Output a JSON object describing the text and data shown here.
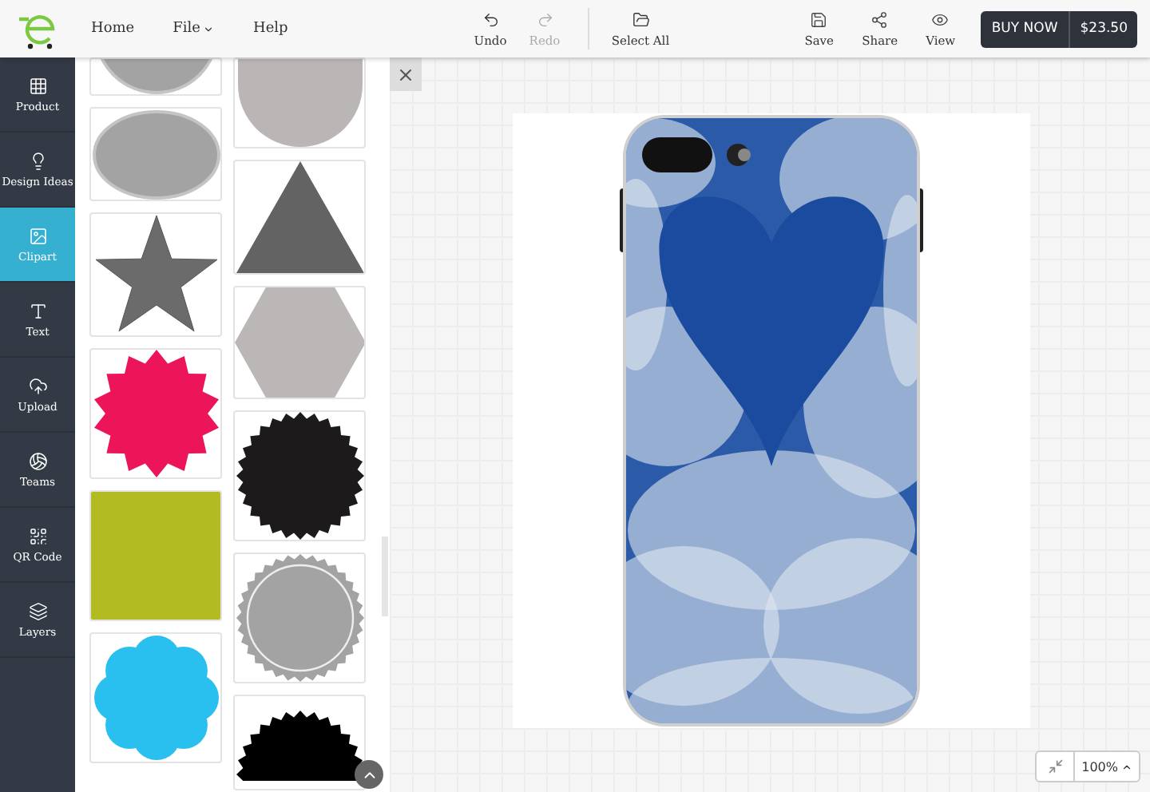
{
  "menu": [
    {
      "label": "Home"
    },
    {
      "label": "File",
      "dropdown": true
    },
    {
      "label": "Help"
    }
  ],
  "toolbar": [
    {
      "label": "Undo",
      "disabled": false
    },
    {
      "label": "Redo",
      "disabled": true
    },
    {
      "label": "Select All",
      "disabled": false
    }
  ],
  "actions": [
    {
      "label": "Save"
    },
    {
      "label": "Share"
    },
    {
      "label": "View"
    }
  ],
  "buy_button": {
    "label": "BUY NOW",
    "price": "$23.50"
  },
  "sidebar": {
    "items": [
      {
        "label": "Product",
        "selected": false
      },
      {
        "label": "Design Ideas",
        "selected": false
      },
      {
        "label": "Clipart",
        "selected": true
      },
      {
        "label": "Text",
        "selected": false
      },
      {
        "label": "Upload",
        "selected": false
      },
      {
        "label": "Teams",
        "selected": false
      },
      {
        "label": "QR Code",
        "selected": false
      },
      {
        "label": "Layers",
        "selected": false
      }
    ]
  },
  "clipart": {
    "columns": [
      [
        {
          "kind": "circle-bottom",
          "color": "#a3a3a3"
        },
        {
          "kind": "ellipse",
          "color": "#a3a3a3"
        },
        {
          "kind": "star",
          "color": "#6b6b6b"
        },
        {
          "kind": "burst",
          "color": "#ec1559"
        },
        {
          "kind": "square",
          "color": "#b2bb22"
        },
        {
          "kind": "flower",
          "color": "#29c0ef"
        }
      ],
      [
        {
          "kind": "half-circle",
          "color": "#bab6b5"
        },
        {
          "kind": "triangle",
          "color": "#636363"
        },
        {
          "kind": "hexagon",
          "color": "#bbb7b6"
        },
        {
          "kind": "seal",
          "color": "#1c1a1b"
        },
        {
          "kind": "badge",
          "color": "#a3a3a3"
        },
        {
          "kind": "seal-top",
          "color": "#000000"
        }
      ]
    ]
  },
  "zoom": {
    "label": "100%"
  }
}
